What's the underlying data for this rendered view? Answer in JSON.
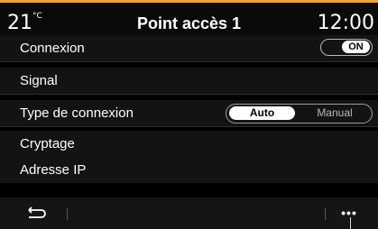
{
  "header": {
    "temperature": "21",
    "temperature_unit": "°C",
    "title": "Point accès 1",
    "clock": "12:00"
  },
  "settings": {
    "connection": {
      "label": "Connexion",
      "toggle_value": "ON"
    },
    "signal": {
      "label": "Signal"
    },
    "connection_type": {
      "label": "Type de connexion",
      "options": [
        "Auto",
        "Manual"
      ],
      "selected": "Auto"
    },
    "encryption": {
      "label": "Cryptage"
    },
    "ip_address": {
      "label": "Adresse IP"
    }
  },
  "footer": {
    "back_icon": "return-arrow-icon",
    "more_icon": "more-options-icon",
    "more_label": "•••"
  },
  "colors": {
    "accent": "#f2a33a",
    "background": "#000000",
    "row_background": "#131313",
    "footer_background": "#151515"
  }
}
